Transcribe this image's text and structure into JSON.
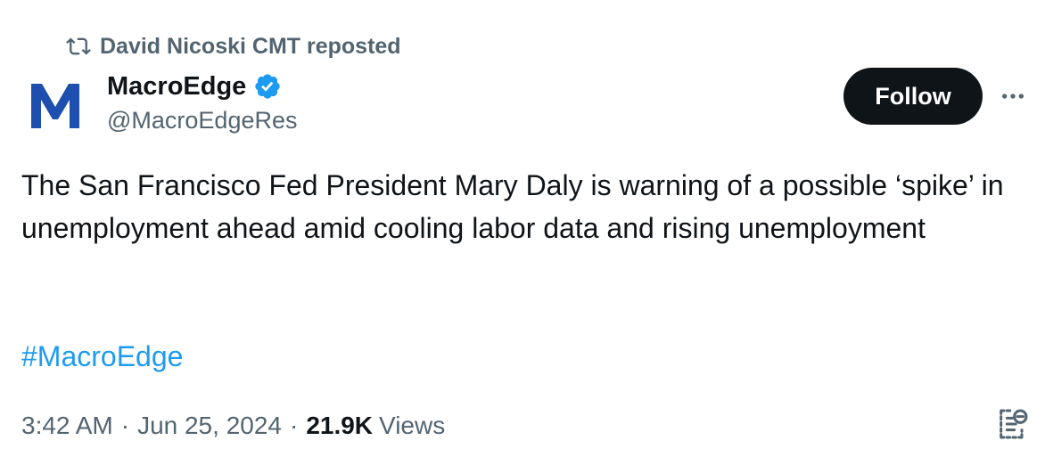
{
  "repost": {
    "icon": "repost-icon",
    "text": "David Nicoski CMT reposted"
  },
  "author": {
    "avatar_icon": "macroedge-logo",
    "avatar_letter": "M",
    "name": "MacroEdge",
    "verified_icon": "verified-badge-icon",
    "handle": "@MacroEdgeRes"
  },
  "actions": {
    "follow_label": "Follow",
    "more_icon": "more-options-icon"
  },
  "tweet": {
    "text": "The San Francisco Fed President Mary Daly is warning of a possible ‘spike’ in unemployment ahead amid cooling labor data and rising unemployment",
    "hashtag": "#MacroEdge"
  },
  "meta": {
    "time": "3:42 AM",
    "separator": "·",
    "date": "Jun 25, 2024",
    "views_count": "21.9K",
    "views_label": "Views",
    "analytics_icon": "analytics-icon"
  },
  "colors": {
    "text_primary": "#0f1419",
    "text_secondary": "#536471",
    "link": "#1d9bf0",
    "verified": "#1d9bf0",
    "logo_blue": "#1f4fae",
    "button_bg": "#0f1419"
  }
}
